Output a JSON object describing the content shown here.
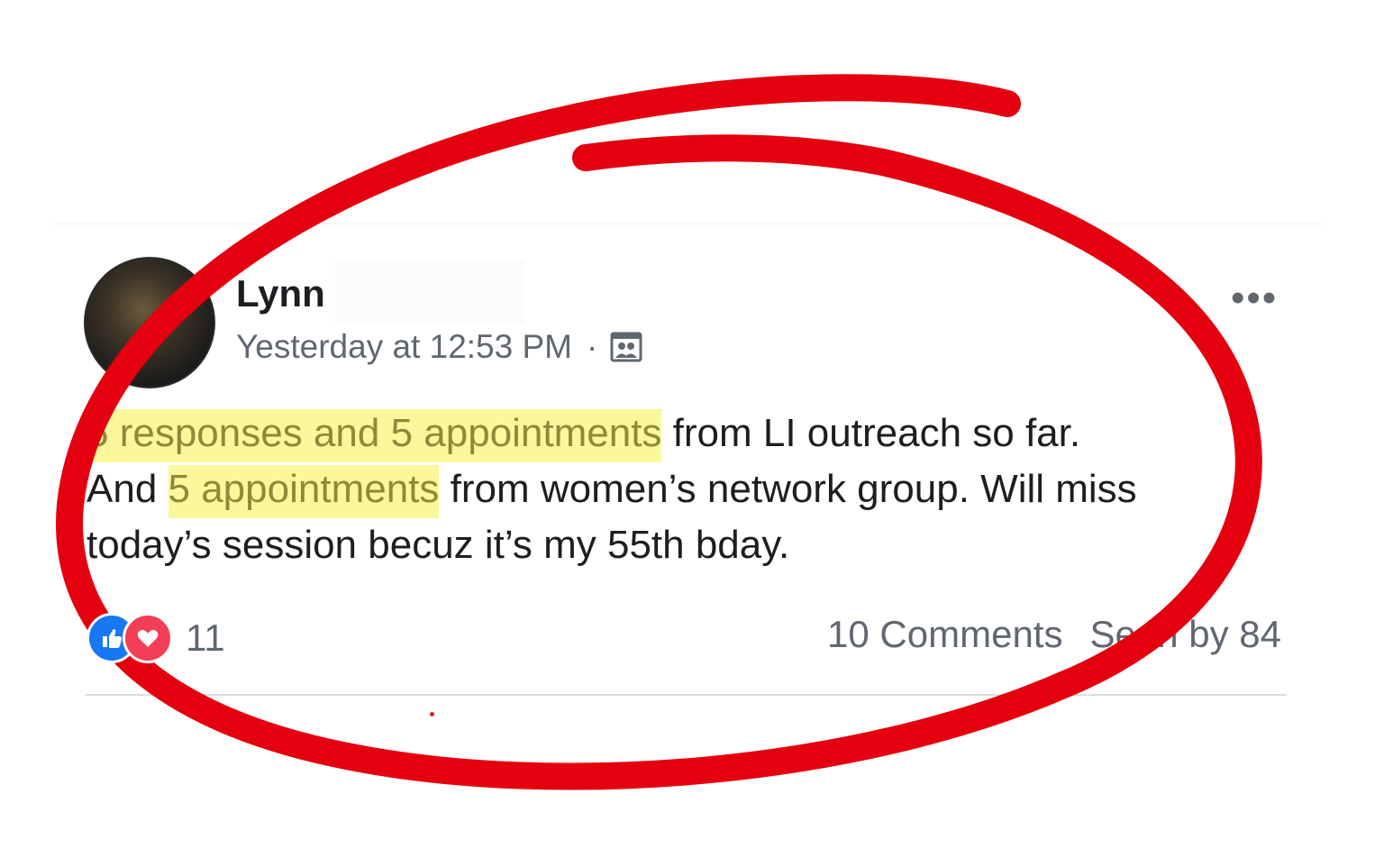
{
  "post": {
    "author": "Lynn",
    "timestamp": "Yesterday at 12:53 PM",
    "separator": "·",
    "audience_icon": "group-icon",
    "more_label": "•••",
    "text": {
      "line1_highlight": "5 responses and 5 appointments",
      "line1_rest": " from LI outreach so far.",
      "line2_start": "And ",
      "line2_highlight": "5 appointments",
      "line2_rest": " from women’s network group. Will miss",
      "line3": "today’s session becuz it’s my 55th bday."
    },
    "reactions": {
      "icons": [
        "like-icon",
        "love-icon"
      ],
      "count": "11"
    },
    "stats": {
      "comments": "10 Comments",
      "seen": "Seen by 84"
    }
  },
  "colors": {
    "highlight": "#fbf79b",
    "highlight_text": "#8e8a3a",
    "annotation_red": "#e4000f",
    "like_blue": "#1877f2",
    "love_red": "#f33e58"
  }
}
